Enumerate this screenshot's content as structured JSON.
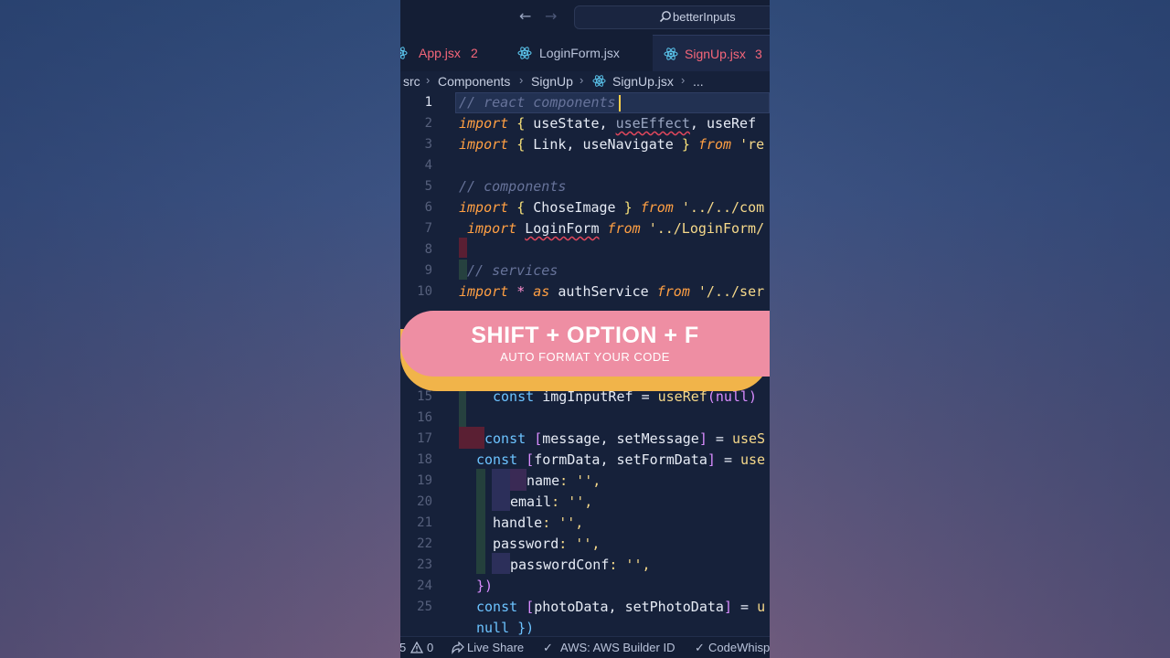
{
  "titlebar": {
    "back_icon": "arrow-left",
    "forward_icon": "arrow-right",
    "search_label": "betterInputs"
  },
  "tabs": [
    {
      "label": "App.jsx",
      "problems": "2",
      "state": "error"
    },
    {
      "label": "LoginForm.jsx",
      "problems": "",
      "state": "normal"
    },
    {
      "label": "SignUp.jsx",
      "problems": "3",
      "state": "error-active"
    }
  ],
  "breadcrumb": [
    "src",
    "Components",
    "SignUp",
    "SignUp.jsx",
    "..."
  ],
  "editor": {
    "active_line": "1",
    "line_numbers": [
      "1",
      "2",
      "3",
      "4",
      "5",
      "6",
      "7",
      "8",
      "9",
      "10",
      "15",
      "16",
      "17",
      "18",
      "19",
      "20",
      "21",
      "22",
      "23",
      "24",
      "25"
    ]
  },
  "code": {
    "l1": {
      "comment": "// react components"
    },
    "l2": {
      "kw": "import",
      "b1": "{",
      "a": "useState",
      "c1": ",",
      "b": "useEffect",
      "c2": ",",
      "c": "useRef"
    },
    "l3": {
      "kw": "import",
      "b1": "{",
      "a": "Link",
      "c1": ",",
      "b": "useNavigate",
      "b2": "}",
      "from": "from",
      "str": "'re"
    },
    "l5": {
      "comment": "// components"
    },
    "l6": {
      "kw": "import",
      "b1": "{",
      "a": "ChoseImage",
      "b2": "}",
      "from": "from",
      "str": "'../../com"
    },
    "l7": {
      "kw": "import",
      "a": "LoginForm",
      "from": "from",
      "str": "'../LoginForm/"
    },
    "l9": {
      "comment": "// services"
    },
    "l10": {
      "kw": "import",
      "star": "*",
      "as": "as",
      "a": "authService",
      "from": "from",
      "str": "'/../ser"
    },
    "l15": {
      "kw": "const",
      "a": "imgInputRef",
      "eq": "=",
      "fn": "useRef",
      "args": "(null)"
    },
    "l17": {
      "kw": "const",
      "b1": "[",
      "a": "message",
      "c1": ",",
      "b": "setMessage",
      "b2": "]",
      "eq": "=",
      "fn": "useS"
    },
    "l18": {
      "kw": "const",
      "b1": "[",
      "a": "formData",
      "c1": ",",
      "b": "setFormData",
      "b2": "]",
      "eq": "=",
      "fn": "use"
    },
    "l19": {
      "prop": "name",
      "rest": ": '',"
    },
    "l20": {
      "prop": "email",
      "rest": ": '',"
    },
    "l21": {
      "prop": "handle",
      "rest": ": '',"
    },
    "l22": {
      "prop": "password",
      "rest": ": '',"
    },
    "l23": {
      "prop": "passwordConf",
      "rest": ": '',"
    },
    "l24": {
      "close": "})"
    },
    "l25": {
      "kw": "const",
      "b1": "[",
      "a": "photoData",
      "c1": ",",
      "b": "setPhotoData",
      "b2": "]",
      "eq": "=",
      "fn": "u"
    },
    "l26": {
      "text": "null })"
    }
  },
  "banner": {
    "title": "SHIFT + OPTION + F",
    "subtitle": "AUTO FORMAT YOUR CODE"
  },
  "statusbar": {
    "errors": "5",
    "warnings": "0",
    "live_share": "Live Share",
    "aws": "AWS: AWS Builder ID",
    "codewhisperer": "CodeWhisp"
  },
  "colors": {
    "editor_bg": "#16213a",
    "keyword": "#ff9f43",
    "string": "#f6d98a",
    "comment": "#67739a",
    "error": "#f5667a",
    "banner_pink": "#ee8ea3",
    "banner_orange": "#f1b44a"
  }
}
